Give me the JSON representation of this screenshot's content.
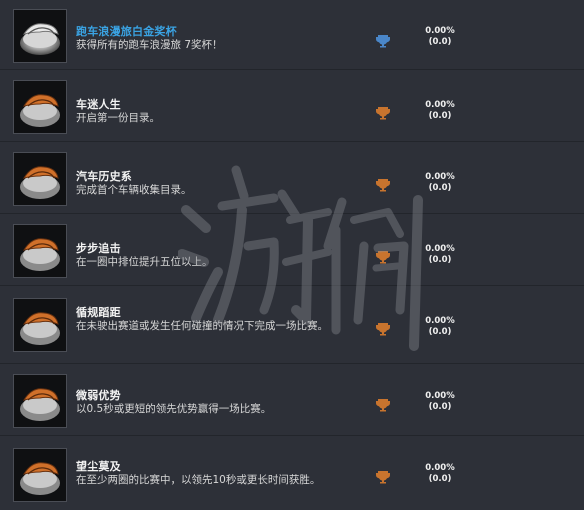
{
  "achievements": [
    {
      "title": "跑车浪漫旅白金奖杯",
      "desc": "获得所有的跑车浪漫旅 7奖杯！",
      "trophy": "platinum",
      "pct": "0.00%",
      "count": "(0.0)"
    },
    {
      "title": "车迷人生",
      "desc": "开启第一份目录。",
      "trophy": "bronze",
      "pct": "0.00%",
      "count": "(0.0)"
    },
    {
      "title": "汽车历史系",
      "desc": "完成首个车辆收集目录。",
      "trophy": "bronze",
      "pct": "0.00%",
      "count": "(0.0)"
    },
    {
      "title": "步步追击",
      "desc": "在一圈中排位提升五位以上。",
      "trophy": "bronze",
      "pct": "0.00%",
      "count": "(0.0)"
    },
    {
      "title": "循规蹈距",
      "desc": "在未驶出赛道或发生任何碰撞的情况下完成一场比赛。",
      "trophy": "bronze",
      "pct": "0.00%",
      "count": "(0.0)"
    },
    {
      "title": "微弱优势",
      "desc": "以0.5秒或更短的领先优势赢得一场比赛。",
      "trophy": "bronze",
      "pct": "0.00%",
      "count": "(0.0)"
    },
    {
      "title": "望尘莫及",
      "desc": "在至少两圈的比赛中，以领先10秒或更长时间获胜。",
      "trophy": "bronze",
      "pct": "0.00%",
      "count": "(0.0)"
    }
  ],
  "colors": {
    "platinum_title": "#3aa3e3",
    "platinum_trophy": "#4a86c8",
    "bronze_trophy": "#c8742e",
    "background": "#2d3038"
  },
  "icons": {
    "achievement": "car-trophy-icon",
    "trophy": "trophy-icon"
  }
}
